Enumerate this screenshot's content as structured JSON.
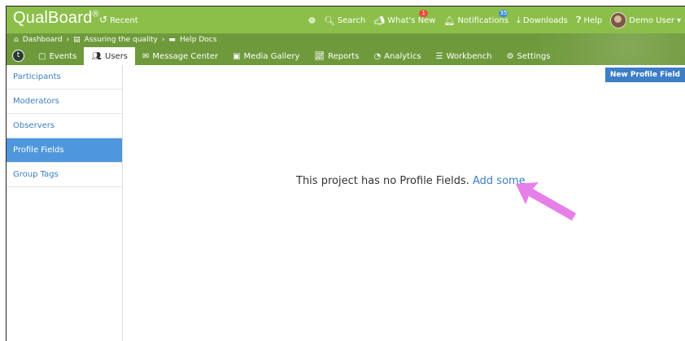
{
  "header": {
    "brand": "QualBoard",
    "brand_mark": "®",
    "recent_label": "Recent",
    "search_label": "Search",
    "whats_new_label": "What's New",
    "whats_new_badge": "1",
    "notifications_label": "Notifications",
    "notifications_badge": "35",
    "downloads_label": "Downloads",
    "help_label": "Help",
    "user_label": "Demo User"
  },
  "breadcrumb": {
    "items": [
      "Dashboard",
      "Assuring the quality",
      "Help Docs"
    ]
  },
  "nav": {
    "icon_letter": "t",
    "tabs": [
      "Events",
      "Users",
      "Message Center",
      "Media Gallery",
      "Reports",
      "Analytics",
      "Workbench",
      "Settings"
    ]
  },
  "sidebar": {
    "items": [
      "Participants",
      "Moderators",
      "Observers",
      "Profile Fields",
      "Group Tags"
    ]
  },
  "main": {
    "new_button": "New Profile Field",
    "empty_text": "This project has no Profile Fields.",
    "empty_link": "Add some"
  },
  "colors": {
    "top_green": "#8cbf4a",
    "nav_green": "#6f9a3c",
    "accent_blue": "#4e97dc",
    "annotation_arrow": "#e77fe9"
  }
}
